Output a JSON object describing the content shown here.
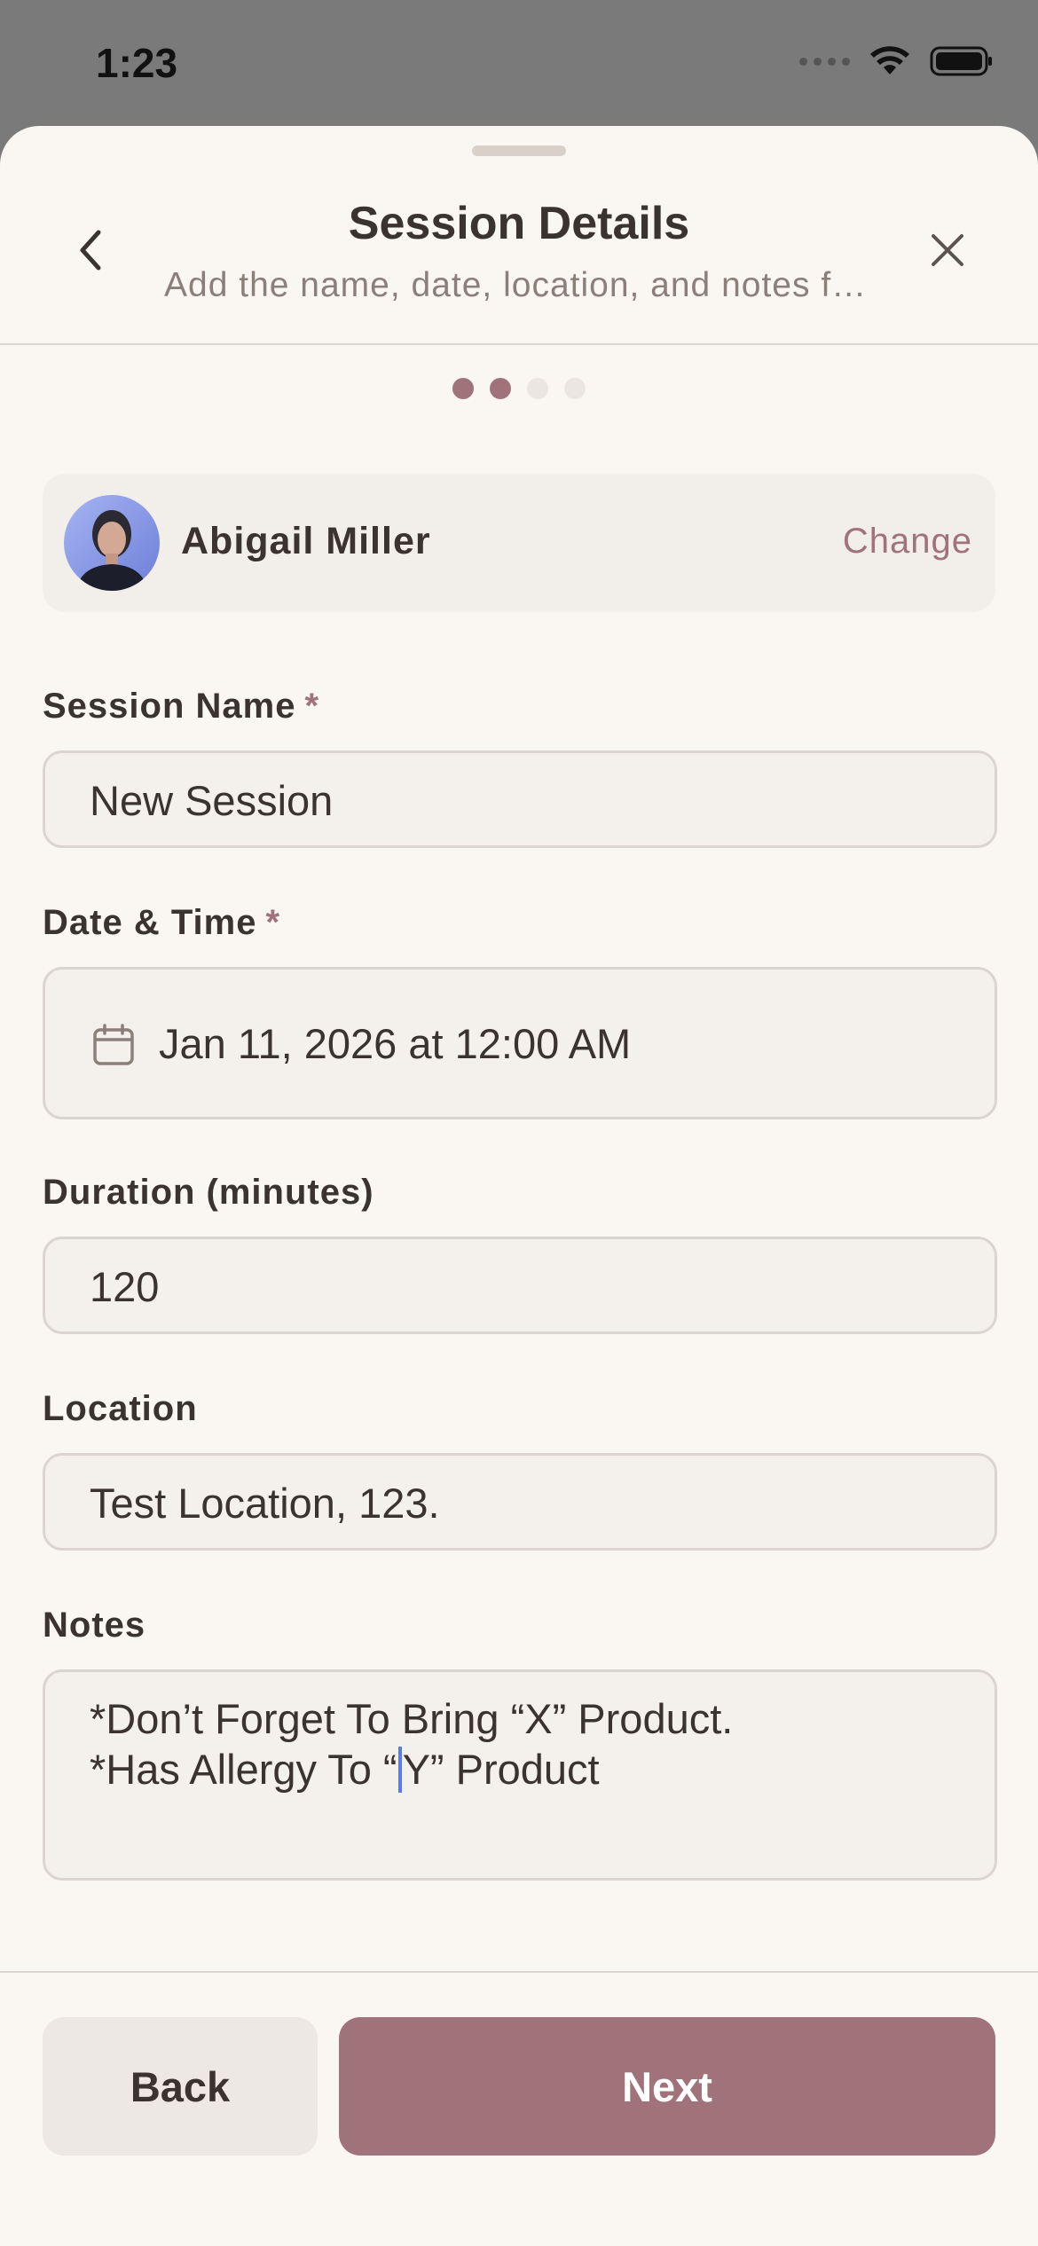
{
  "status_bar": {
    "time": "1:23"
  },
  "header": {
    "title": "Session Details",
    "subtitle": "Add the name, date, location, and notes for this session",
    "back_icon": "chevron-left-icon",
    "close_icon": "close-icon"
  },
  "progress": {
    "steps": 4,
    "current_step": 2
  },
  "client": {
    "name": "Abigail Miller",
    "change_label": "Change"
  },
  "form": {
    "session_name": {
      "label": "Session Name",
      "required_mark": "*",
      "value": "New Session"
    },
    "date_time": {
      "label": "Date & Time",
      "required_mark": "*",
      "value": "Jan 11, 2026 at 12:00 AM",
      "icon": "calendar-icon"
    },
    "duration": {
      "label": "Duration (minutes)",
      "value": "120"
    },
    "location": {
      "label": "Location",
      "value": "Test Location, 123."
    },
    "notes": {
      "label": "Notes",
      "line1": "*Don’t Forget To Bring “X” Product.",
      "line2_before_cursor": "*Has Allergy To “",
      "line2_after_cursor": "Y” Product"
    }
  },
  "footer": {
    "back_label": "Back",
    "next_label": "Next"
  },
  "colors": {
    "accent": "#a0737a",
    "background": "#faf7f2",
    "field_bg": "#f4f1ec",
    "text": "#3b3330"
  }
}
